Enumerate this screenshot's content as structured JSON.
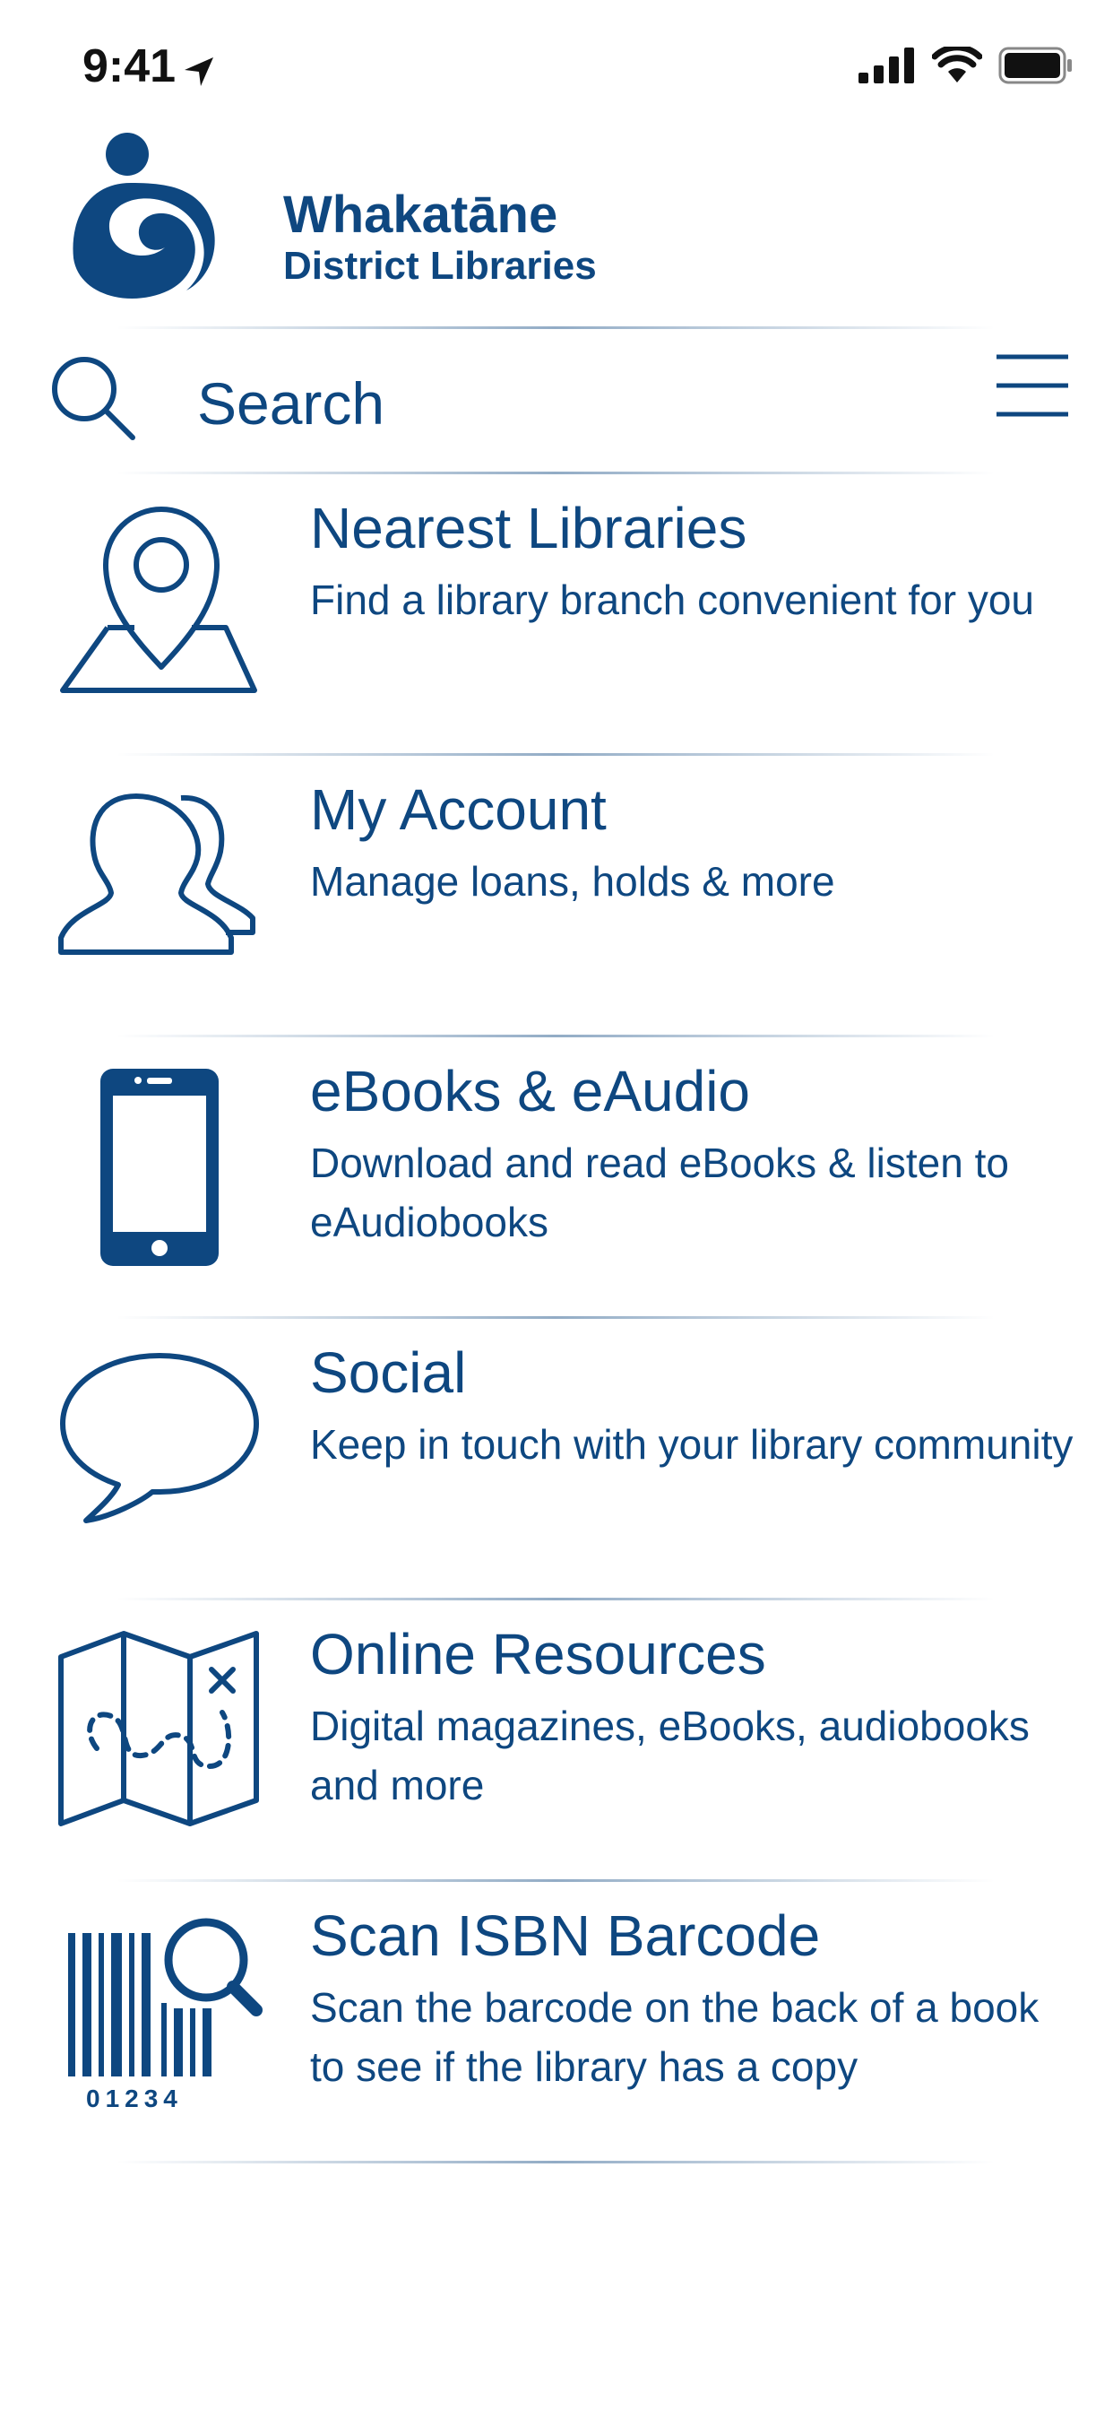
{
  "status_bar": {
    "time": "9:41",
    "icons": [
      "location-arrow-icon",
      "signal-icon",
      "wifi-icon",
      "battery-icon"
    ]
  },
  "logo": {
    "title": "Whakatāne",
    "subtitle": "District Libraries"
  },
  "search": {
    "placeholder": "Search"
  },
  "menu_items": [
    {
      "icon": "map-pin-icon",
      "title": "Nearest Libraries",
      "description": "Find a library branch convenient for you"
    },
    {
      "icon": "users-icon",
      "title": "My Account",
      "description": "Manage loans, holds & more"
    },
    {
      "icon": "smartphone-icon",
      "title": "eBooks & eAudio",
      "description": "Download and read eBooks & listen to eAudiobooks"
    },
    {
      "icon": "speech-bubble-icon",
      "title": "Social",
      "description": "Keep in touch with your library community"
    },
    {
      "icon": "treasure-map-icon",
      "title": "Online Resources",
      "description": "Digital magazines, eBooks, audiobooks and more"
    },
    {
      "icon": "barcode-search-icon",
      "title": "Scan ISBN Barcode",
      "description": "Scan the barcode on the back of a book to see if the library has a copy",
      "barcode_digits": "01234"
    }
  ],
  "colors": {
    "brand": "#0e4780",
    "background": "#ffffff"
  }
}
